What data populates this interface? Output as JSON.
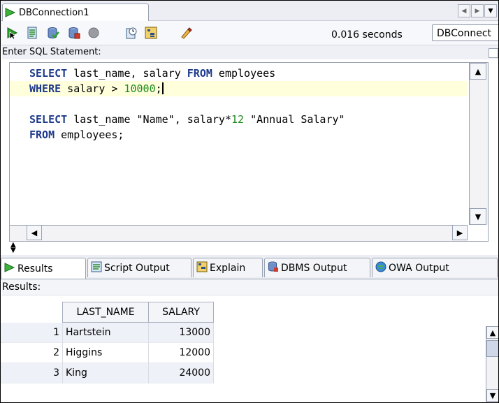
{
  "document_tab": {
    "label": "DBConnection1"
  },
  "toolbar": {
    "elapsed": "0.016 seconds",
    "connection": "DBConnect",
    "icons": [
      "run-statement-icon",
      "run-script-icon",
      "commit-icon",
      "rollback-icon",
      "cancel-icon",
      "sql-history-icon",
      "explain-plan-icon",
      "clear-icon"
    ]
  },
  "editor": {
    "label": "Enter SQL Statement:",
    "lines": [
      [
        {
          "t": "SELECT",
          "k": "kw"
        },
        {
          "t": " last_name, salary "
        },
        {
          "t": "FROM",
          "k": "kw"
        },
        {
          "t": " employees"
        }
      ],
      [
        {
          "t": "WHERE",
          "k": "kw"
        },
        {
          "t": " salary > "
        },
        {
          "t": "10000",
          "k": "num"
        },
        {
          "t": ";"
        }
      ],
      [],
      [
        {
          "t": "SELECT",
          "k": "kw"
        },
        {
          "t": " last_name \"Name\", salary*"
        },
        {
          "t": "12",
          "k": "num"
        },
        {
          "t": " \"Annual Salary\""
        }
      ],
      [
        {
          "t": "FROM",
          "k": "kw"
        },
        {
          "t": " employees;"
        }
      ]
    ]
  },
  "result_tabs": [
    {
      "label": "Results",
      "icon": "run-icon",
      "active": true
    },
    {
      "label": "Script Output",
      "icon": "script-output-icon",
      "active": false
    },
    {
      "label": "Explain",
      "icon": "explain-icon",
      "active": false
    },
    {
      "label": "DBMS Output",
      "icon": "dbms-output-icon",
      "active": false
    },
    {
      "label": "OWA Output",
      "icon": "owa-output-icon",
      "active": false
    }
  ],
  "results": {
    "label": "Results:",
    "columns": [
      "LAST_NAME",
      "SALARY"
    ],
    "rows": [
      {
        "n": "1",
        "last_name": "Hartstein",
        "salary": "13000"
      },
      {
        "n": "2",
        "last_name": "Higgins",
        "salary": "12000"
      },
      {
        "n": "3",
        "last_name": "King",
        "salary": "24000"
      }
    ]
  },
  "colors": {
    "keyword": "#1e3a8c",
    "number": "#1e8a1e",
    "current_line": "#ffffdc",
    "run_green": "#2fa22f"
  }
}
